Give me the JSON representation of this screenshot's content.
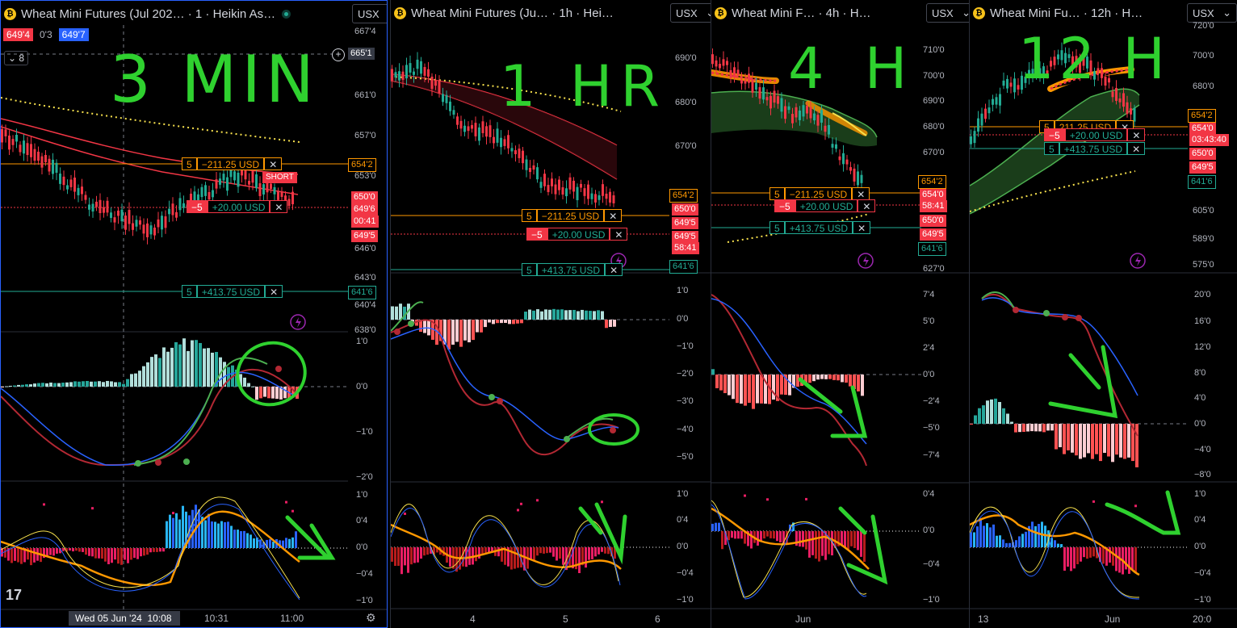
{
  "panes": [
    {
      "title": "Wheat Mini Futures (Jul 202… · 1 · Heikin As…",
      "currency": "USX",
      "bid": "649'4",
      "spread": "0'3",
      "ask": "649'7",
      "interval_badge": "8",
      "crosshair_price": "665'1",
      "price_axis": [
        "667'4",
        "661'0",
        "657'0",
        "653'0",
        "646'0",
        "643'0",
        "640'4",
        "638'0"
      ],
      "price_labels": [
        {
          "text": "654'2",
          "style": "orange"
        },
        {
          "text": "650'0",
          "style": "red"
        },
        {
          "text": "649'6",
          "style": "red"
        },
        {
          "text": "00:41",
          "style": "red"
        },
        {
          "text": "649'5",
          "style": "red"
        },
        {
          "text": "641'6",
          "style": "teal"
        }
      ],
      "orders": [
        {
          "qty": "5",
          "pnl": "−211.25 USD",
          "style": "orange"
        },
        {
          "qty": "−5",
          "pnl": "+20.00 USD",
          "style": "red"
        },
        {
          "qty": "5",
          "pnl": "+413.75 USD",
          "style": "teal"
        }
      ],
      "short_label": "SHORT",
      "macd_axis": [
        "1'0",
        "0'0",
        "−1'0",
        "−2'0"
      ],
      "osc_axis": [
        "1'0",
        "0'4",
        "0'0",
        "−0'4",
        "−1'0"
      ],
      "time_axis": [
        "Wed 05 Jun '24",
        "10:08",
        "10:31",
        "11:00"
      ],
      "annotation": "3 MIN"
    },
    {
      "title": "Wheat Mini Futures (Ju… · 1h · Hei…",
      "currency": "USX",
      "price_axis": [
        "690'0",
        "680'0",
        "670'0"
      ],
      "price_labels": [
        {
          "text": "654'2",
          "style": "orange"
        },
        {
          "text": "650'0",
          "style": "red"
        },
        {
          "text": "649'5",
          "style": "red"
        },
        {
          "text": "649'5",
          "style": "red"
        },
        {
          "text": "58:41",
          "style": "red"
        },
        {
          "text": "641'6",
          "style": "teal"
        }
      ],
      "orders": [
        {
          "qty": "5",
          "pnl": "−211.25 USD",
          "style": "orange"
        },
        {
          "qty": "−5",
          "pnl": "+20.00 USD",
          "style": "red"
        },
        {
          "qty": "5",
          "pnl": "+413.75 USD",
          "style": "teal"
        }
      ],
      "macd_axis": [
        "1'0",
        "0'0",
        "−1'0",
        "−2'0",
        "−3'0",
        "−4'0",
        "−5'0"
      ],
      "osc_axis": [
        "1'0",
        "0'4",
        "0'0",
        "−0'4",
        "−1'0"
      ],
      "time_axis": [
        "4",
        "5",
        "6"
      ],
      "annotation": "1 HR"
    },
    {
      "title": "Wheat Mini F… · 4h · H…",
      "currency": "USX",
      "price_axis": [
        "710'0",
        "700'0",
        "690'0",
        "680'0",
        "670'0",
        "627'0"
      ],
      "price_labels": [
        {
          "text": "654'2",
          "style": "orange"
        },
        {
          "text": "654'0",
          "style": "red"
        },
        {
          "text": "58:41",
          "style": "red"
        },
        {
          "text": "650'0",
          "style": "red"
        },
        {
          "text": "649'5",
          "style": "red"
        },
        {
          "text": "641'6",
          "style": "teal"
        }
      ],
      "orders": [
        {
          "qty": "5",
          "pnl": "−211.25 USD",
          "style": "orange"
        },
        {
          "qty": "−5",
          "pnl": "+20.00 USD",
          "style": "red"
        },
        {
          "qty": "5",
          "pnl": "+413.75 USD",
          "style": "teal"
        }
      ],
      "macd_axis": [
        "7'4",
        "5'0",
        "2'4",
        "0'0",
        "−2'4",
        "−5'0",
        "−7'4"
      ],
      "osc_axis": [
        "0'4",
        "0'0",
        "−0'4",
        "−1'0"
      ],
      "time_axis": [
        "Jun"
      ],
      "annotation": "4 H"
    },
    {
      "title": "Wheat Mini Fu… · 12h · H…",
      "currency": "USX",
      "price_axis": [
        "720'0",
        "700'0",
        "680'0",
        "605'0",
        "589'0",
        "575'0"
      ],
      "price_labels": [
        {
          "text": "654'2",
          "style": "orange"
        },
        {
          "text": "654'0",
          "style": "red"
        },
        {
          "text": "03:43:40",
          "style": "red"
        },
        {
          "text": "650'0",
          "style": "red"
        },
        {
          "text": "649'5",
          "style": "red"
        },
        {
          "text": "641'6",
          "style": "teal"
        }
      ],
      "orders": [
        {
          "qty": "5",
          "pnl": "211.25 USD",
          "style": "orange"
        },
        {
          "qty": "−5",
          "pnl": "+20.00 USD",
          "style": "red"
        },
        {
          "qty": "5",
          "pnl": "+413.75 USD",
          "style": "teal"
        }
      ],
      "macd_axis": [
        "20'0",
        "16'0",
        "12'0",
        "8'0",
        "4'0",
        "0'0",
        "−4'0",
        "−8'0"
      ],
      "osc_axis": [
        "1'0",
        "0'4",
        "0'0",
        "−0'4",
        "−1'0"
      ],
      "time_axis": [
        "13",
        "Jun",
        "20:0"
      ],
      "annotation": "12 H"
    }
  ]
}
